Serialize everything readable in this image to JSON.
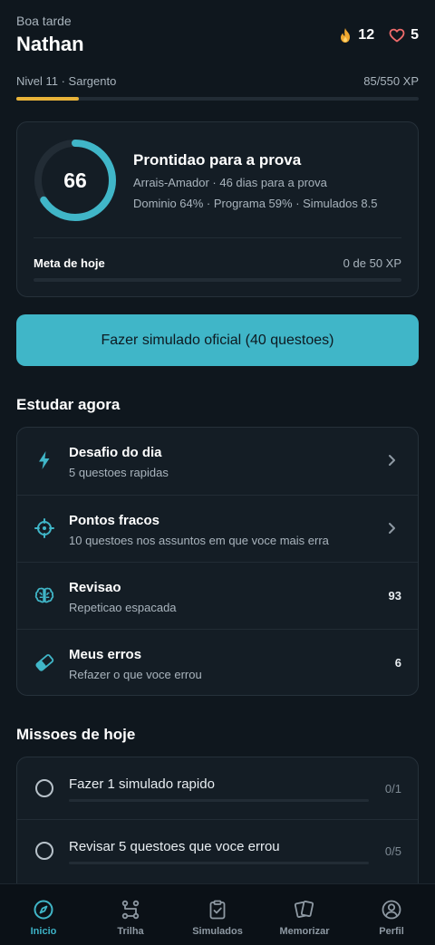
{
  "header": {
    "greeting": "Boa tarde",
    "name": "Nathan",
    "streak": "12",
    "lives": "5"
  },
  "level": {
    "label": "Nivel 11 · Sargento",
    "xp": "85/550 XP",
    "progress": 0.155
  },
  "readiness": {
    "score": "66",
    "score_value": 66,
    "title": "Prontidao para a prova",
    "subtitle": "Arrais-Amador · 46 dias para a prova",
    "details": "Dominio 64% · Programa 59% · Simulados 8.5",
    "goal_label": "Meta de hoje",
    "goal_value": "0 de 50 XP",
    "goal_progress": 0
  },
  "cta": {
    "label": "Fazer simulado oficial (40 questoes)"
  },
  "study": {
    "title": "Estudar agora",
    "items": [
      {
        "title": "Desafio do dia",
        "subtitle": "5 questoes rapidas",
        "icon": "lightning-icon"
      },
      {
        "title": "Pontos fracos",
        "subtitle": "10 questoes nos assuntos em que voce mais erra",
        "icon": "crosshair-icon"
      },
      {
        "title": "Revisao",
        "subtitle": "Repeticao espacada",
        "count": "93",
        "icon": "brain-icon"
      },
      {
        "title": "Meus erros",
        "subtitle": "Refazer o que voce errou",
        "count": "6",
        "icon": "eraser-icon"
      }
    ]
  },
  "missions": {
    "title": "Missoes de hoje",
    "items": [
      {
        "title": "Fazer 1 simulado rapido",
        "value": "0/1",
        "progress": 0
      },
      {
        "title": "Revisar 5 questoes que voce errou",
        "value": "0/5",
        "progress": 0
      }
    ]
  },
  "nav": {
    "items": [
      {
        "label": "Inicio",
        "icon": "compass-icon",
        "active": true
      },
      {
        "label": "Trilha",
        "icon": "route-icon"
      },
      {
        "label": "Simulados",
        "icon": "clipboard-check-icon"
      },
      {
        "label": "Memorizar",
        "icon": "cards-icon"
      },
      {
        "label": "Perfil",
        "icon": "user-circle-icon"
      }
    ]
  },
  "colors": {
    "accent": "#40b6c8",
    "xp": "#e8b339",
    "background": "#0f171e",
    "card": "#141d25"
  }
}
